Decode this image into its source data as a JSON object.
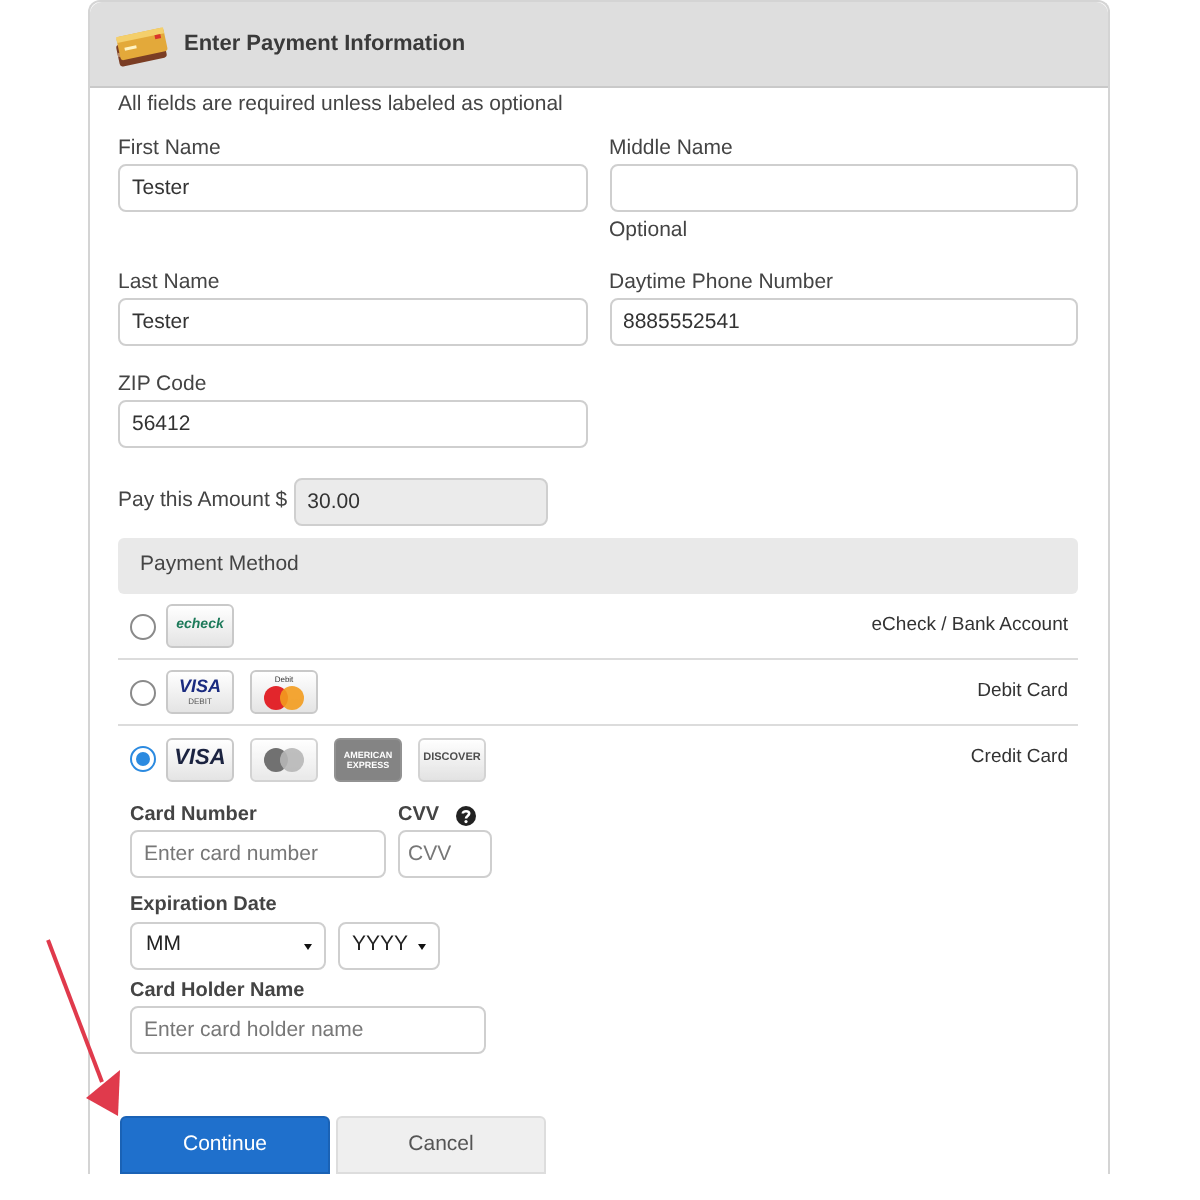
{
  "panel": {
    "title": "Enter Payment Information",
    "note": "All fields are required unless labeled as optional"
  },
  "fields": [
    {
      "label": "First Name",
      "value": "Tester"
    },
    {
      "label": "Middle Name",
      "hint": "Optional"
    },
    {
      "label": "Last Name",
      "value": "Tester"
    },
    {
      "label": "Daytime Phone Number",
      "value": "8885552541"
    },
    {
      "label": "ZIP Code",
      "value": "56412"
    }
  ],
  "amount": {
    "label": "Pay this Amount $",
    "value": "30.00",
    "disabled": true
  },
  "payment_method": {
    "title": "Payment Method",
    "options": [
      {
        "label": "eCheck / Bank Account",
        "selected": false,
        "logos": [
          {
            "kind": "echeck",
            "text": "echeck",
            "muted": false
          }
        ]
      },
      {
        "label": "Debit Card",
        "selected": false,
        "logos": [
          {
            "kind": "visa",
            "text": "VISA",
            "subtext": "DEBIT",
            "muted": false
          },
          {
            "kind": "circles",
            "text": "Debit",
            "muted": false
          }
        ]
      },
      {
        "label": "Credit Card",
        "selected": true,
        "logos": [
          {
            "kind": "visa",
            "text": "VISA",
            "muted": false
          },
          {
            "kind": "circles",
            "muted": true
          },
          {
            "kind": "amex",
            "text": "AMERICAN EXPRESS",
            "muted": true
          },
          {
            "kind": "discover",
            "text": "DISCOVER",
            "muted": true
          }
        ]
      }
    ]
  },
  "card_form": {
    "card_number": {
      "label": "Card Number",
      "placeholder": "Enter card number"
    },
    "cvv": {
      "label": "CVV",
      "placeholder": "CVV",
      "help": true
    },
    "expiration": {
      "label": "Expiration Date",
      "month": "MM",
      "year": "YYYY"
    },
    "holder": {
      "label": "Card Holder Name",
      "placeholder": "Enter card holder name"
    }
  },
  "buttons": [
    {
      "label": "Continue",
      "kind": "primary"
    },
    {
      "label": "Cancel",
      "kind": "secondary"
    }
  ]
}
